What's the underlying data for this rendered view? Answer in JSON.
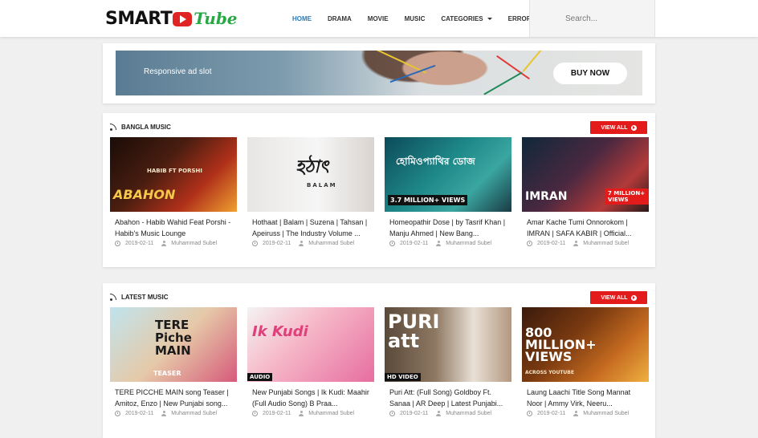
{
  "header": {
    "logo": {
      "part1": "SMART",
      "part2": "Tube"
    },
    "nav": [
      {
        "label": "HOME",
        "active": true
      },
      {
        "label": "DRAMA",
        "active": false
      },
      {
        "label": "MOVIE",
        "active": false
      },
      {
        "label": "MUSIC",
        "active": false
      },
      {
        "label": "CATEGORIES",
        "active": false,
        "dropdown": true
      },
      {
        "label": "ERROR PAGE",
        "active": false
      }
    ],
    "search": {
      "placeholder": "Search..."
    }
  },
  "ad": {
    "text": "Responsive ad slot",
    "button": "BUY NOW"
  },
  "sections": [
    {
      "title": "BANGLA MUSIC",
      "view_all": "VIEW ALL",
      "cards": [
        {
          "title": "Abahon - Habib Wahid Feat Porshi - Habib's Music Lounge",
          "date": "2019-02-11",
          "author": "Muhammad Subel",
          "thumb_text": "ABAHON",
          "thumb_sub": "HABIB FT PORSHI"
        },
        {
          "title": "Hothaat | Balam | Suzena | Tahsan | Apeiruss | The Industry Volume ...",
          "date": "2019-02-11",
          "author": "Muhammad Subel",
          "thumb_text": "হঠাৎ",
          "thumb_sub": "BALAM"
        },
        {
          "title": "Homeopathir Dose | by Tasrif Khan | Manju Ahmed | New Bang...",
          "date": "2019-02-11",
          "author": "Muhammad Subel",
          "thumb_text": "হোমিওপ্যাথির ডোজ",
          "thumb_sub": "3.7 MILLION+ VIEWS"
        },
        {
          "title": "Amar Kache Tumi Onnorokom | IMRAN | SAFA KABIR | Official...",
          "date": "2019-02-11",
          "author": "Muhammad Subel",
          "thumb_text": "IMRAN",
          "thumb_sub": "7 MILLION+ VIEWS"
        }
      ]
    },
    {
      "title": "LATEST MUSIC",
      "view_all": "VIEW ALL",
      "cards": [
        {
          "title": "TERE PICCHE MAIN song Teaser | Amitoz, Enzo | New Punjabi song...",
          "date": "2019-02-11",
          "author": "Muhammad Subel",
          "thumb_text": "TERE Piche MAIN",
          "thumb_sub": "TEASER"
        },
        {
          "title": "New Punjabi Songs | Ik Kudi: Maahir (Full Audio Song) B Praa...",
          "date": "2019-02-11",
          "author": "Muhammad Subel",
          "thumb_text": "Ik Kudi",
          "thumb_sub": "AUDIO"
        },
        {
          "title": "Puri Att: (Full Song) Goldboy Ft. Sanaa | AR Deep | Latest Punjabi...",
          "date": "2019-02-11",
          "author": "Muhammad Subel",
          "thumb_text": "PURI att",
          "thumb_sub": "HD VIDEO"
        },
        {
          "title": "Laung Laachi Title Song Mannat Noor | Ammy Virk, Neeru...",
          "date": "2019-02-11",
          "author": "Muhammad Subel",
          "thumb_text": "800 MILLION+ VIEWS",
          "thumb_sub": "ACROSS YOUTUBE"
        }
      ]
    }
  ],
  "colors": {
    "accent": "#e41b1b",
    "nav_active": "#2b7bb9",
    "logo_green": "#28a745"
  }
}
